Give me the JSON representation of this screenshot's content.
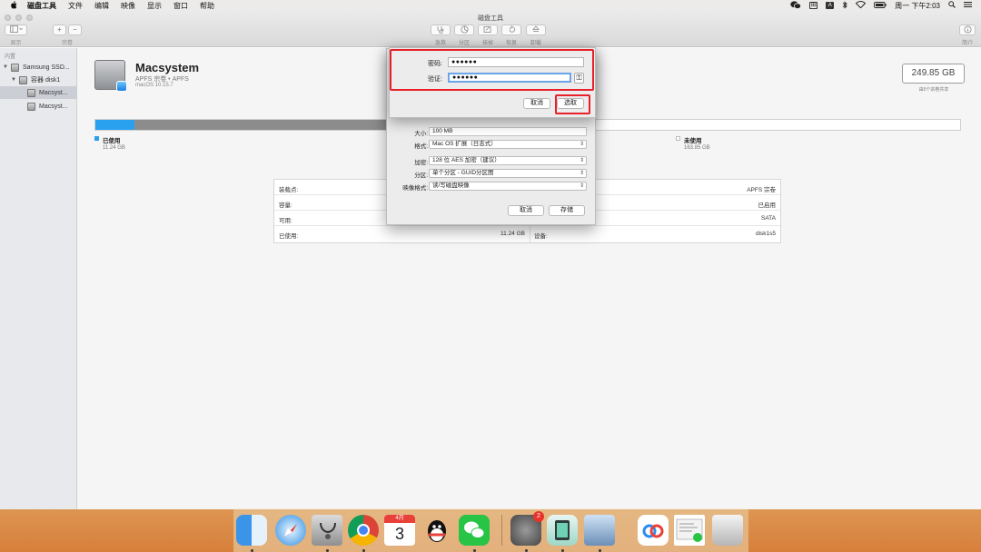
{
  "menubar": {
    "apple": "",
    "app_name": "磁盘工具",
    "items": [
      "文件",
      "编辑",
      "映像",
      "显示",
      "窗口",
      "帮助"
    ],
    "input_badge_1": "田",
    "input_badge_2": "A",
    "datetime": "周一 下午2:03"
  },
  "window": {
    "title": "磁盘工具",
    "toolbar": {
      "view_label": "显示",
      "volume_label": "宗卷",
      "add_glyph": "+",
      "remove_glyph": "−",
      "firstaid_label": "急救",
      "partition_label": "分区",
      "erase_label": "抹掉",
      "restore_label": "恢复",
      "unmount_label": "卸载",
      "info_label": "简介"
    }
  },
  "sidebar": {
    "header": "内置",
    "items": [
      {
        "label": "Samsung SSD..."
      },
      {
        "label": "容器 disk1"
      },
      {
        "label": "Macsyst..."
      },
      {
        "label": "Macsyst..."
      }
    ]
  },
  "volume": {
    "name": "Macsystem",
    "subtitle": "APFS 宗卷 • APFS",
    "os": "macOS 10.15.7",
    "capacity": "249.85 GB",
    "capacity_note": "由5个宗卷共享",
    "used_fraction": 0.045,
    "other_fraction": 0.3,
    "legend": [
      {
        "label": "已使用",
        "value": "11.24 GB",
        "color": "#2aa1ee"
      },
      {
        "label": "未使用",
        "value": "163.85 GB",
        "color": "#ffffff"
      }
    ]
  },
  "info_table": [
    {
      "left_label": "装载点:",
      "left_value": "",
      "right_label": "",
      "right_value": "APFS 宗卷"
    },
    {
      "left_label": "容量:",
      "left_value": "",
      "right_label": "",
      "right_value": "已启用"
    },
    {
      "left_label": "可用:",
      "left_value": "",
      "right_label": "",
      "right_value": "SATA"
    },
    {
      "left_label": "已使用:",
      "left_value": "11.24 GB",
      "right_label": "设备:",
      "right_value": "disk1s5"
    }
  ],
  "save_sheet": {
    "size_label": "大小:",
    "size_value": "100 MB",
    "format_label": "格式:",
    "format_value": "Mac OS 扩展（日志式）",
    "encryption_label": "加密:",
    "encryption_value": "128 位 AES 加密（建议）",
    "partition_label": "分区:",
    "partition_value": "单个分区 - GUID分区图",
    "image_format_label": "映像格式:",
    "image_format_value": "读/写磁盘映像",
    "cancel": "取消",
    "save": "存储"
  },
  "password_sheet": {
    "password_label": "密码:",
    "password_value": "●●●●●●",
    "verify_label": "验证:",
    "verify_value": "●●●●●●",
    "key_glyph": "⚿",
    "cancel": "取消",
    "choose": "选取"
  },
  "dock": {
    "calendar_month": "4月",
    "calendar_day": "3",
    "preferences_badge": "2"
  }
}
